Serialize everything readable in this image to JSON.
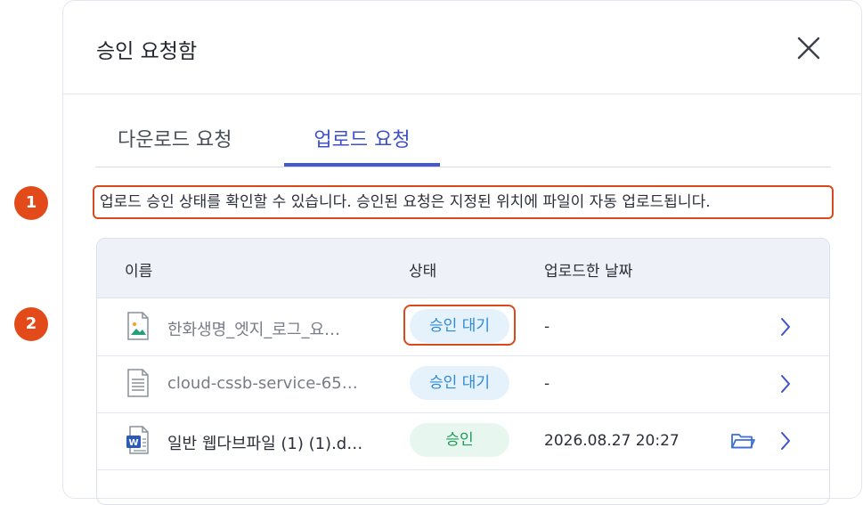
{
  "dialog": {
    "title": "승인 요청함",
    "tabs": [
      {
        "label": "다운로드 요청",
        "active": false
      },
      {
        "label": "업로드 요청",
        "active": true
      }
    ],
    "notice": "업로드 승인 상태를 확인할 수 있습니다. 승인된 요청은 지정된 위치에 파일이 자동 업로드됩니다.",
    "markers": [
      "1",
      "2"
    ],
    "table": {
      "headers": {
        "name": "이름",
        "status": "상태",
        "date": "업로드한 날짜"
      },
      "rows": [
        {
          "name": "한화생명_엣지_로그_요…",
          "status": "승인 대기",
          "date": "-",
          "icon": "image-file-icon"
        },
        {
          "name": "cloud-cssb-service-65…",
          "status": "승인 대기",
          "date": "-",
          "icon": "text-file-icon"
        },
        {
          "name": "일반 웹다브파일 (1) (1).d…",
          "status": "승인",
          "date": "2026.08.27 20:27",
          "icon": "word-file-icon"
        }
      ]
    }
  },
  "colors": {
    "accent": "#4459d0",
    "highlight": "#d84a1c",
    "pending_bg": "#e6f2fb",
    "pending_text": "#2f8ad6",
    "approved_bg": "#e7f7ef",
    "approved_text": "#1f9b5a"
  }
}
